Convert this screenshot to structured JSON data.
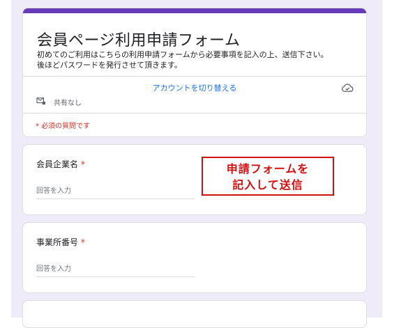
{
  "form": {
    "title": "会員ページ利用申請フォーム",
    "description_line1": "初めてのご利用はこちらの利用申請フォームから必要事項を記入の上、送信下さい。",
    "description_line2": "後ほどパスワードを発行させて頂きます。",
    "switch_account": "アカウントを切り替える",
    "share_status": "共有なし",
    "required_note": "* 必須の質問です",
    "accent_color": "#673ab7",
    "cloud_icon": "cloud-done-icon",
    "share_icon": "mail-lock-icon"
  },
  "questions": [
    {
      "label": "会員企業名",
      "required_mark": "*",
      "placeholder": "回答を入力"
    },
    {
      "label": "事業所番号",
      "required_mark": "*",
      "placeholder": "回答を入力"
    }
  ],
  "annotation": {
    "line1": "申請フォームを",
    "line2": "記入して送信",
    "color": "#d21010"
  }
}
